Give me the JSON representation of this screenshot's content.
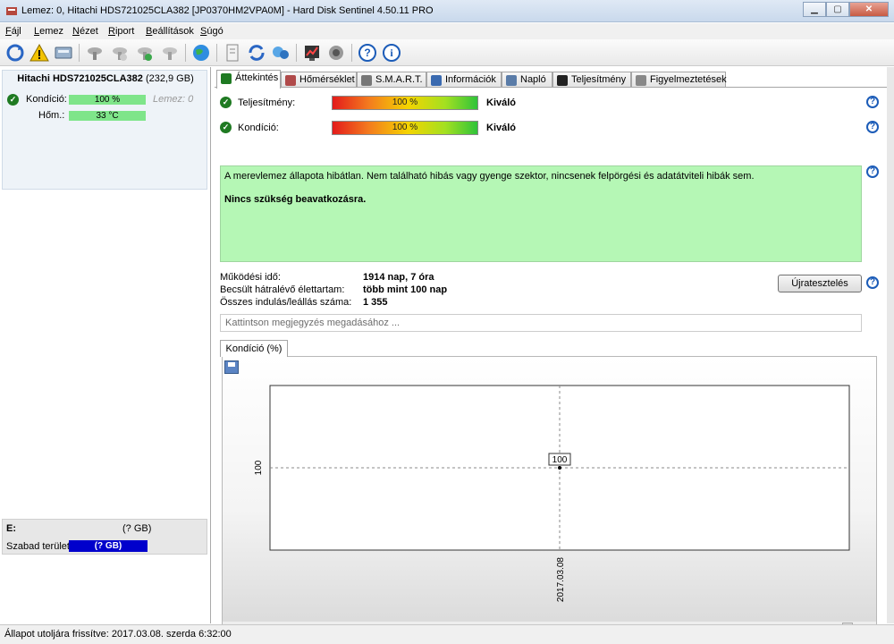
{
  "window": {
    "title": "Lemez: 0, Hitachi HDS721025CLA382 [JP0370HM2VPA0M]  -  Hard Disk Sentinel 4.50.11 PRO",
    "minimize": "▁",
    "maximize": "▢",
    "close": "✕"
  },
  "menu": [
    "Fájl",
    "Lemez",
    "Nézet",
    "Riport",
    "Beállítások",
    "Súgó"
  ],
  "left": {
    "disk_name": "Hitachi HDS721025CLA382",
    "disk_size": "(232,9 GB)",
    "condition_label": "Kondíció:",
    "condition_value": "100 %",
    "disk_label": "Lemez: 0",
    "temp_label": "Hőm.:",
    "temp_value": "33 °C",
    "volume_letter": "E:",
    "volume_size": "(? GB)",
    "free_label": "Szabad terület",
    "free_value": "(? GB)"
  },
  "tabs": [
    {
      "label": "Áttekintés",
      "color": "#1f7a22"
    },
    {
      "label": "Hőmérséklet",
      "color": "#b04a4a"
    },
    {
      "label": "S.M.A.R.T.",
      "color": "#777777"
    },
    {
      "label": "Információk",
      "color": "#3a6ab0"
    },
    {
      "label": "Napló",
      "color": "#5a7ca8"
    },
    {
      "label": "Teljesítmény",
      "color": "#222222"
    },
    {
      "label": "Figyelmeztetések",
      "color": "#888888"
    }
  ],
  "overview": {
    "performance_label": "Teljesítmény:",
    "performance_value": "100 %",
    "performance_rating": "Kiváló",
    "condition_label": "Kondíció:",
    "condition_value": "100 %",
    "condition_rating": "Kiváló",
    "info_text": "A merevlemez állapota hibátlan. Nem található hibás vagy gyenge szektor, nincsenek felpörgési és adatátviteli hibák sem.",
    "info_bold": "Nincs szükség beavatkozásra.",
    "uptime_label": "Működési idő:",
    "uptime_value": "1914 nap, 7 óra",
    "lifetime_label": "Becsült hátralévő élettartam:",
    "lifetime_value": "több mint 100 nap",
    "starts_label": "Összes indulás/leállás száma:",
    "starts_value": "1 355",
    "retest_button": "Újratesztelés",
    "note_placeholder": "Kattintson megjegyzés megadásához ..."
  },
  "chart_tab": "Kondíció  (%)",
  "chart_data": {
    "type": "line",
    "x": [
      "2017.03.08"
    ],
    "values": [
      100
    ],
    "data_labels": [
      "100"
    ],
    "y_tick_labels": [
      "100"
    ],
    "x_tick_labels": [
      "2017.03.08"
    ],
    "grid": true
  },
  "status": "Állapot utoljára frissítve: 2017.03.08. szerda 6:32:00",
  "help_glyph": "?"
}
